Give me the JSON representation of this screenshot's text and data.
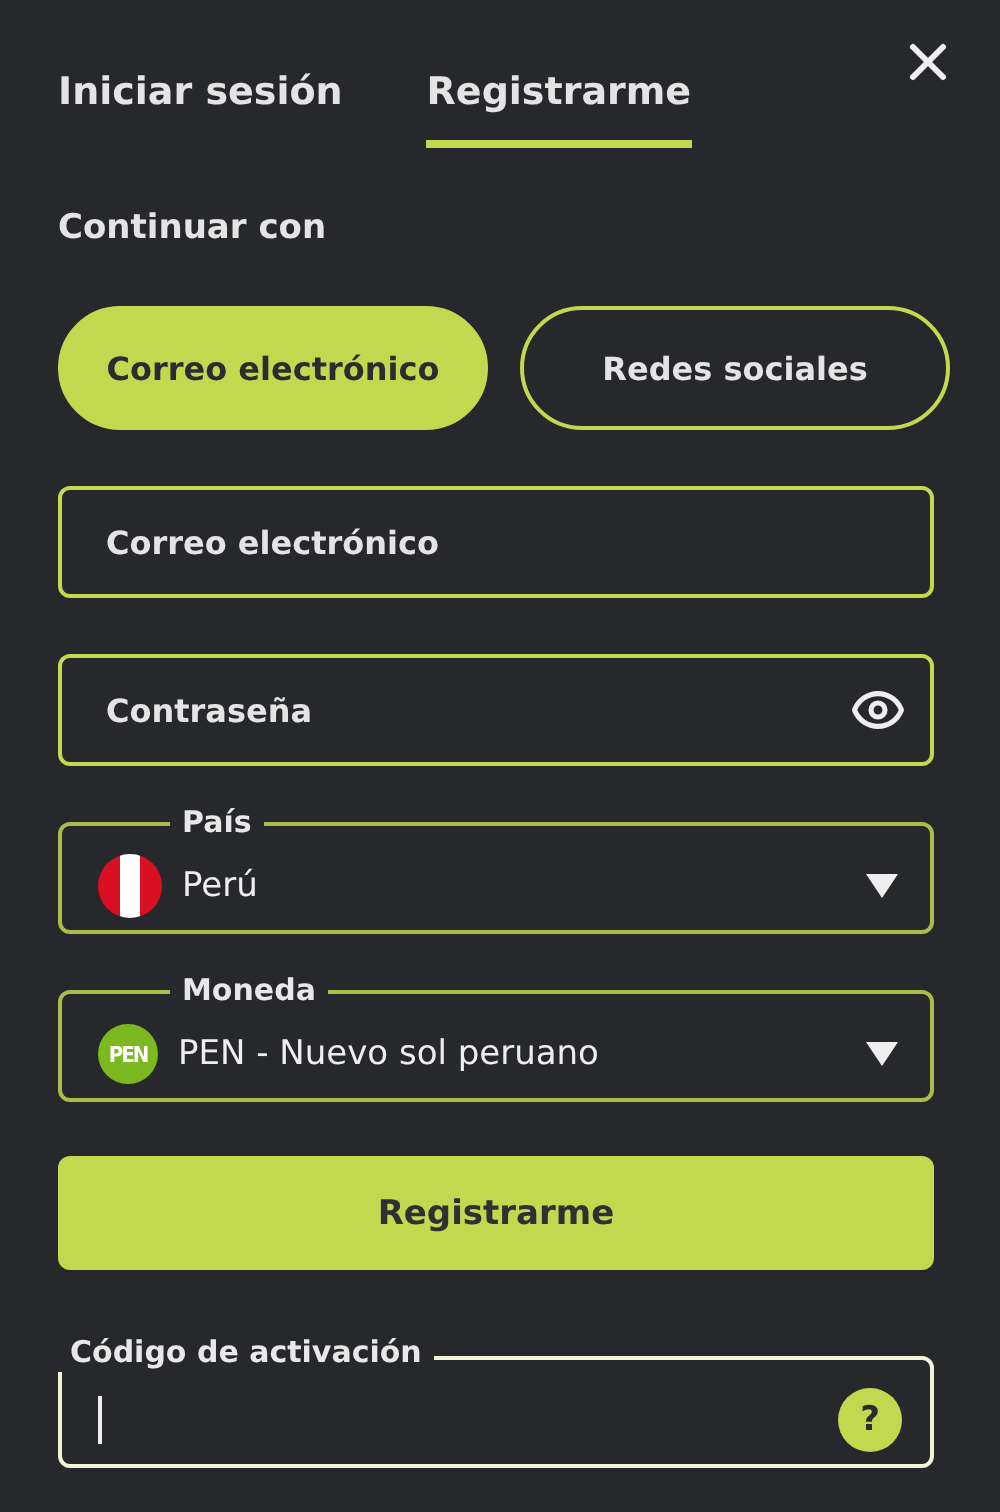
{
  "tabs": [
    {
      "label": "Iniciar sesión",
      "selected": false
    },
    {
      "label": "Registrarme",
      "selected": true
    }
  ],
  "section_label": "Continuar con",
  "methods": [
    {
      "label": "Correo electrónico",
      "selected": true
    },
    {
      "label": "Redes sociales",
      "selected": false
    }
  ],
  "fields": [
    {
      "kind": "text",
      "placeholder": "Correo electrónico"
    },
    {
      "kind": "password",
      "placeholder": "Contraseña"
    },
    {
      "kind": "country",
      "label": "País",
      "value": "Perú"
    },
    {
      "kind": "currency",
      "label": "Moneda",
      "value": "PEN - Nuevo sol peruano",
      "badge": "PEN"
    }
  ],
  "submit": "Registrarme",
  "activation": {
    "label": "Código de activación",
    "focused": true,
    "help": "?"
  }
}
